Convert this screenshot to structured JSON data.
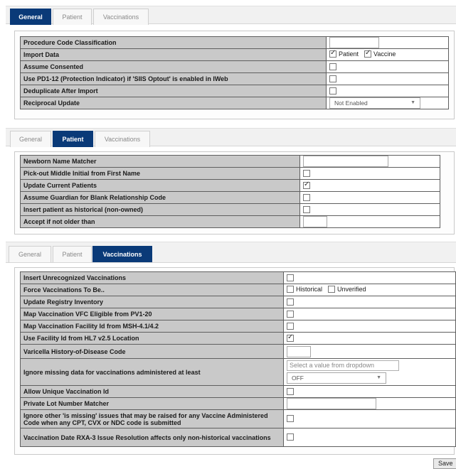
{
  "panel1": {
    "tabs": [
      {
        "label": "General",
        "active": true
      },
      {
        "label": "Patient",
        "active": false
      },
      {
        "label": "Vaccinations",
        "active": false
      }
    ],
    "rows": [
      {
        "label": "Procedure Code Classification",
        "control": "text",
        "value": ""
      },
      {
        "label": "Import Data",
        "control": "checks",
        "options": [
          {
            "label": "Patient",
            "checked": true
          },
          {
            "label": "Vaccine",
            "checked": true
          }
        ]
      },
      {
        "label": "Assume Consented",
        "control": "check",
        "checked": false
      },
      {
        "label": "Use PD1-12 (Protection Indicator) if 'SIIS Optout' is enabled in IWeb",
        "control": "check",
        "checked": false
      },
      {
        "label": "Deduplicate After Import",
        "control": "check",
        "checked": false
      },
      {
        "label": "Reciprocal Update",
        "control": "select",
        "value": "Not Enabled"
      }
    ]
  },
  "panel2": {
    "tabs": [
      {
        "label": "General",
        "active": false
      },
      {
        "label": "Patient",
        "active": true
      },
      {
        "label": "Vaccinations",
        "active": false
      }
    ],
    "rows": [
      {
        "label": "Newborn Name Matcher",
        "control": "text",
        "value": ""
      },
      {
        "label": "Pick-out Middle Initial from First Name",
        "control": "check",
        "checked": false
      },
      {
        "label": "Update Current Patients",
        "control": "check",
        "checked": true
      },
      {
        "label": "Assume Guardian for Blank Relationship Code",
        "control": "check",
        "checked": false
      },
      {
        "label": "Insert patient as historical (non-owned)",
        "control": "check",
        "checked": false
      },
      {
        "label": "Accept if not older than",
        "control": "text",
        "value": ""
      }
    ]
  },
  "panel3": {
    "tabs": [
      {
        "label": "General",
        "active": false
      },
      {
        "label": "Patient",
        "active": false
      },
      {
        "label": "Vaccinations",
        "active": true
      }
    ],
    "rows": [
      {
        "label": "Insert Unrecognized Vaccinations",
        "control": "check",
        "checked": false
      },
      {
        "label": "Force Vaccinations To Be..",
        "control": "checks",
        "options": [
          {
            "label": "Historical",
            "checked": false
          },
          {
            "label": "Unverified",
            "checked": false
          }
        ]
      },
      {
        "label": "Update Registry Inventory",
        "control": "check",
        "checked": false
      },
      {
        "label": "Map Vaccination VFC Eligible from PV1-20",
        "control": "check",
        "checked": false
      },
      {
        "label": "Map Vaccination Facility Id from MSH-4.1/4.2",
        "control": "check",
        "checked": false
      },
      {
        "label": "Use Facility Id from HL7 v2.5 Location",
        "control": "check",
        "checked": true
      },
      {
        "label": "Varicella History-of-Disease Code",
        "control": "text",
        "value": ""
      },
      {
        "label": "Ignore missing data for vaccinations administered at least",
        "control": "combo",
        "placeholder": "Select a value from dropdown",
        "value": "OFF"
      },
      {
        "label": "Allow Unique Vaccination Id",
        "control": "check",
        "checked": false
      },
      {
        "label": "Private Lot Number Matcher",
        "control": "text",
        "value": ""
      },
      {
        "label": "Ignore other 'is missing' issues that may be raised for any Vaccine Administered Code when any CPT, CVX or NDC code is submitted",
        "control": "check",
        "checked": false
      },
      {
        "label": "Vaccination Date RXA-3 Issue Resolution affects only non-historical vaccinations",
        "control": "check",
        "checked": false
      }
    ]
  },
  "save_label": "Save"
}
